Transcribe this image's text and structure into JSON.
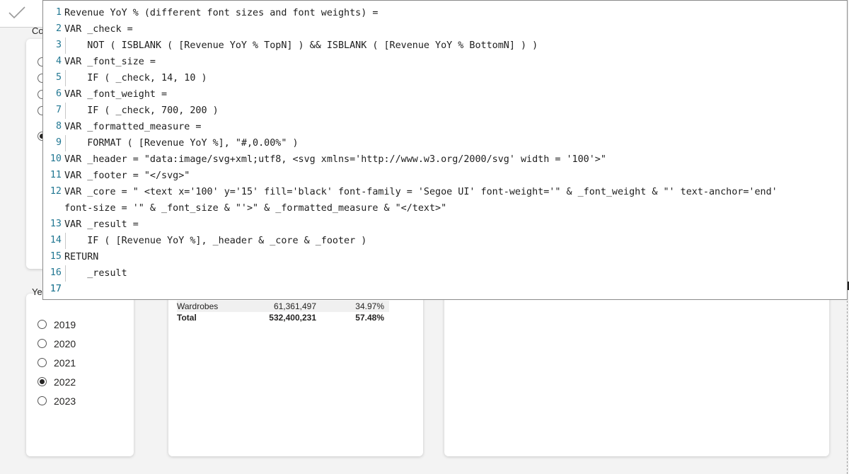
{
  "commit_button": {
    "icon": "checkmark-icon"
  },
  "partial_labels": {
    "slicer_top_title": "Co",
    "slicer_year_title": "Ye"
  },
  "editor": {
    "line_numbers": [
      "1",
      "2",
      "3",
      "4",
      "5",
      "6",
      "7",
      "8",
      "9",
      "10",
      "11",
      "12",
      "13",
      "14",
      "15",
      "16",
      "17"
    ],
    "lines": [
      "Revenue YoY % (different font sizes and font weights) =",
      "VAR _check =",
      "    NOT ( ISBLANK ( [Revenue YoY % TopN] ) && ISBLANK ( [Revenue YoY % BottomN] ) )",
      "VAR _font_size =",
      "    IF ( _check, 14, 10 )",
      "VAR _font_weight =",
      "    IF ( _check, 700, 200 )",
      "VAR _formatted_measure =",
      "    FORMAT ( [Revenue YoY %], \"#,0.00%\" )",
      "VAR _header = \"data:image/svg+xml;utf8, <svg xmlns='http://www.w3.org/2000/svg' width = '100'>\"",
      "VAR _footer = \"</svg>\"",
      "VAR _core = \" <text x='100' y='15' fill='black' font-family = 'Segoe UI' font-weight='\" & _font_weight & \"' text-anchor='end'",
      "font-size = '\" & _font_size & \"'>\" & _formatted_measure & \"</text>\"",
      "VAR _result =",
      "    IF ( [Revenue YoY %], _header & _core & _footer )",
      "RETURN",
      "    _result",
      ""
    ]
  },
  "year_slicer": {
    "options": [
      {
        "label": "2019",
        "selected": false
      },
      {
        "label": "2020",
        "selected": false
      },
      {
        "label": "2021",
        "selected": false
      },
      {
        "label": "2022",
        "selected": true
      },
      {
        "label": "2023",
        "selected": false
      }
    ]
  },
  "top_slicer": {
    "visible_radios": [
      false,
      false,
      false,
      false,
      true
    ]
  },
  "table": {
    "rows": [
      {
        "name": "Wardrobes",
        "revenue": "61,361,497",
        "yoy": "34.97%"
      }
    ],
    "total": {
      "name": "Total",
      "revenue": "532,400,231",
      "yoy": "57.48%"
    }
  }
}
